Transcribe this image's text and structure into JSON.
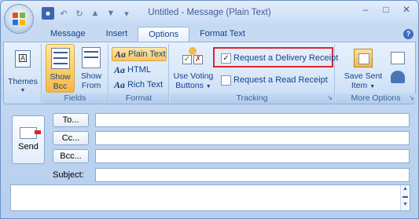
{
  "window": {
    "title": "Untitled - Message (Plain Text)"
  },
  "quick_access": {
    "save_icon": "save-icon",
    "undo_icon": "undo-icon",
    "redo_icon": "redo-icon",
    "up_icon": "up-arrow-icon",
    "down_icon": "down-arrow-icon",
    "customize_icon": "customize-qat-icon"
  },
  "tabs": [
    {
      "label": "Message"
    },
    {
      "label": "Insert"
    },
    {
      "label": "Options"
    },
    {
      "label": "Format Text"
    }
  ],
  "active_tab": "Options",
  "ribbon": {
    "themes_label": "Themes",
    "fields": {
      "show_bcc_line1": "Show",
      "show_bcc_line2": "Bcc",
      "show_from_line1": "Show",
      "show_from_line2": "From",
      "group_label": "Fields"
    },
    "format": {
      "plain_text": "Plain Text",
      "html": "HTML",
      "rich_text": "Rich Text",
      "group_label": "Format"
    },
    "tracking": {
      "use_voting_line1": "Use Voting",
      "use_voting_line2": "Buttons",
      "delivery_receipt": "Request a Delivery Receipt",
      "delivery_checked": true,
      "read_receipt": "Request a Read Receipt",
      "read_checked": false,
      "group_label": "Tracking"
    },
    "more_options": {
      "save_sent_line1": "Save Sent",
      "save_sent_line2": "Item",
      "group_label": "More Options"
    }
  },
  "message": {
    "send_label": "Send",
    "to_label": "To...",
    "cc_label": "Cc...",
    "bcc_label": "Bcc...",
    "subject_label": "Subject:",
    "to_value": "",
    "cc_value": "",
    "bcc_value": "",
    "subject_value": ""
  },
  "colors": {
    "accent": "#15428b",
    "highlight": "#f9c55f",
    "callout": "#d9262f"
  }
}
